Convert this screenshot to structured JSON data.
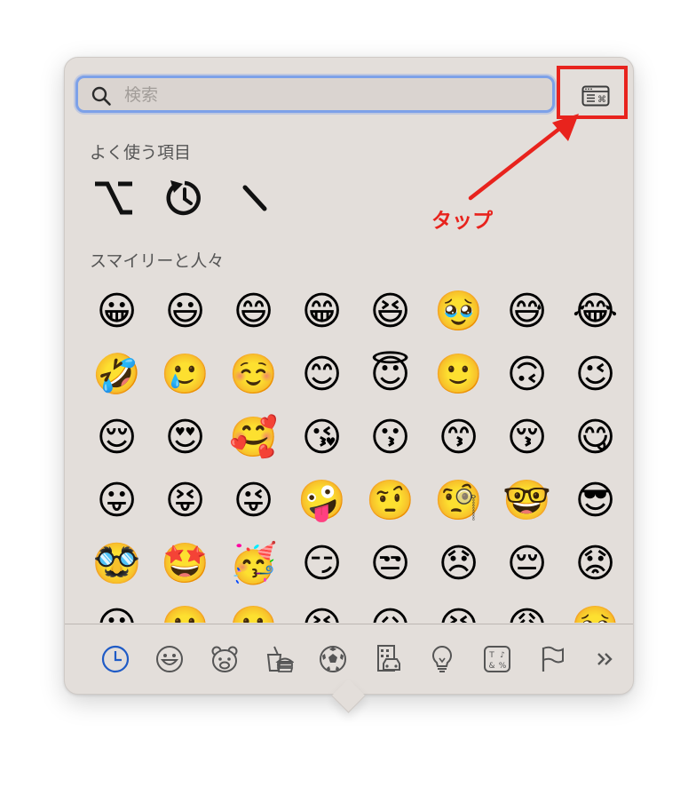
{
  "search": {
    "placeholder": "検索",
    "value": ""
  },
  "toolbar": {
    "viewer_icon": "character-viewer-icon"
  },
  "frequently_used": {
    "title": "よく使う項目",
    "items": [
      {
        "glyph": "option-key-symbol",
        "label": "⌥"
      },
      {
        "glyph": "undo-circle-symbol",
        "label": "⟲"
      },
      {
        "glyph": "backslash-stroke",
        "label": "\\"
      }
    ]
  },
  "smileys": {
    "title": "スマイリーと人々",
    "emojis": [
      "😀",
      "😃",
      "😄",
      "😁",
      "😆",
      "🥹",
      "😅",
      "😂",
      "🤣",
      "🥲",
      "☺️",
      "😊",
      "😇",
      "🙂",
      "🙃",
      "😉",
      "😌",
      "😍",
      "🥰",
      "😘",
      "😗",
      "😙",
      "😚",
      "😋",
      "😛",
      "😝",
      "😜",
      "🤪",
      "🤨",
      "🧐",
      "🤓",
      "😎",
      "🥸",
      "🤩",
      "🥳",
      "😏",
      "😒",
      "😞",
      "😔",
      "😟",
      "😕",
      "🙁",
      "☹️",
      "😣",
      "😖",
      "😫",
      "😩",
      "🥺"
    ]
  },
  "categories": [
    {
      "name": "frequently-used",
      "icon": "clock-icon",
      "active": true
    },
    {
      "name": "smileys-people",
      "icon": "smiley-icon"
    },
    {
      "name": "animals-nature",
      "icon": "bear-icon"
    },
    {
      "name": "food-drink",
      "icon": "food-icon"
    },
    {
      "name": "activity",
      "icon": "soccer-ball-icon"
    },
    {
      "name": "travel-places",
      "icon": "building-car-icon"
    },
    {
      "name": "objects",
      "icon": "lightbulb-icon"
    },
    {
      "name": "symbols",
      "icon": "symbols-icon"
    },
    {
      "name": "flags",
      "icon": "flag-icon"
    },
    {
      "name": "more",
      "icon": "double-chevron-icon"
    }
  ],
  "annotation": {
    "label": "タップ",
    "color": "#e8231d"
  },
  "colors": {
    "accent": "#1f5bc6",
    "panel": "#e3deda",
    "search_border": "#7da1e8"
  }
}
